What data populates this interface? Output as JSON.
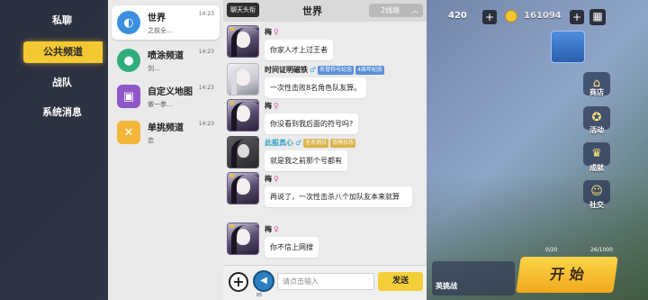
{
  "left_nav": {
    "items": [
      {
        "label": "私聊"
      },
      {
        "label": "公共频道",
        "active": true
      },
      {
        "label": "战队"
      },
      {
        "label": "系统消息"
      }
    ]
  },
  "channels": [
    {
      "name": "世界",
      "time": "14:23",
      "preview": "之前全…",
      "icon": "globe-icon",
      "color": "#3a8fe0",
      "active": true
    },
    {
      "name": "喷涂频道",
      "time": "14:23",
      "preview": "剑…",
      "icon": "palette-icon",
      "color": "#2fae7c"
    },
    {
      "name": "自定义地图",
      "time": "14:23",
      "preview": "做一参…",
      "icon": "map-icon",
      "color": "#8e58c9"
    },
    {
      "name": "单挑频道",
      "time": "14:23",
      "preview": "恋",
      "icon": "crossed-swords-icon",
      "color": "#f2b638"
    }
  ],
  "chat": {
    "frame_button": "聊天头衔",
    "title": "世界",
    "line_select": "2线路",
    "messages": [
      {
        "name": "梅",
        "gender": "♀",
        "badges": [],
        "text": "你家人才上过王者"
      },
      {
        "name": "时间证明磁铁",
        "gender": "♂",
        "badges": [
          "名誉称号纪念",
          "4周年纪念"
        ],
        "text": "一次性击败8名角色队友算。"
      },
      {
        "name": "梅",
        "gender": "♀",
        "badges": [],
        "text": "你没看到我后面的符号吗?"
      },
      {
        "name": "此般真心",
        "gender": "♂",
        "badges": [
          "无名佣兵",
          "恐怖狂热"
        ],
        "text": "就是我之前那个号都有"
      },
      {
        "name": "梅",
        "gender": "♀",
        "badges": [],
        "text": "再说了，一次性击杀八个加队友本来就算"
      },
      {
        "name": "梅",
        "gender": "♀",
        "badges": [],
        "text": "你不信上网搜"
      }
    ],
    "input_placeholder": "请点击输入",
    "voice_count": "85",
    "send_label": "发送"
  },
  "hud": {
    "value_420": "420",
    "coins": "161094",
    "side_buttons": [
      {
        "label": "商店",
        "icon": "shop-icon"
      },
      {
        "label": "活动",
        "icon": "event-icon"
      },
      {
        "label": "成就",
        "icon": "trophy-icon"
      },
      {
        "label": "社交",
        "icon": "social-icon"
      }
    ],
    "start_label": "开 始",
    "room_count": "26/1000",
    "team_count": "0/20",
    "mode_label": "英挑战"
  },
  "colors": {
    "accent_yellow": "#f2c833",
    "send_yellow": "#f5cf3a",
    "female": "#e64fa0",
    "male": "#3da0e8"
  }
}
